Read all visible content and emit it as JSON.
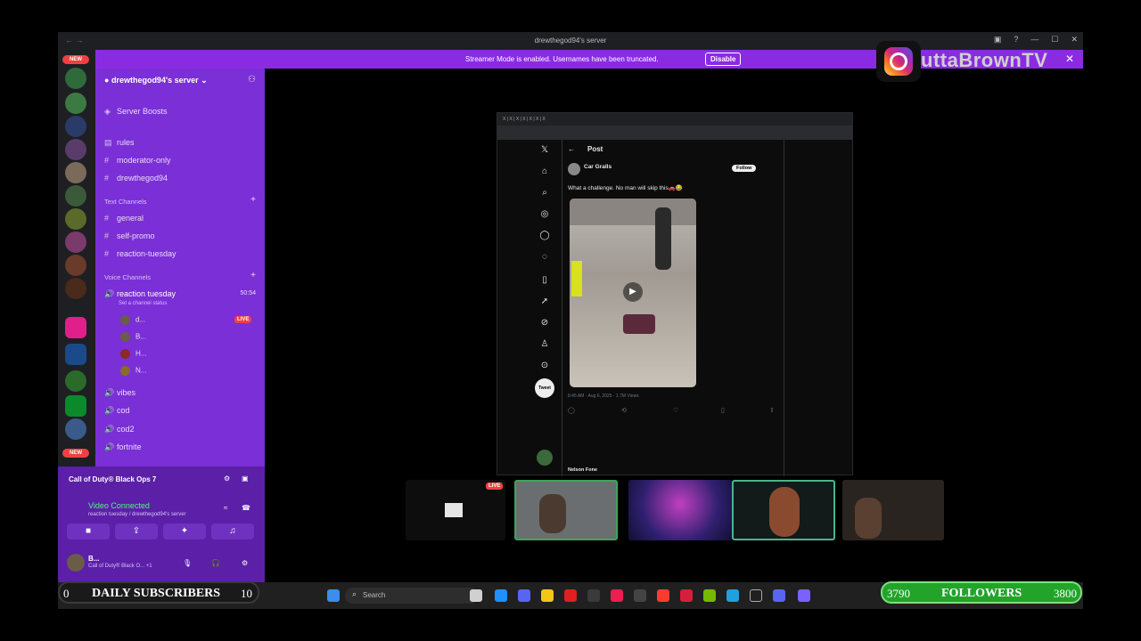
{
  "titlebar": {
    "title": "drewthegod94's server",
    "nav": "←  →"
  },
  "banner": {
    "message": "Streamer Mode is enabled. Usernames have been truncated.",
    "disable_label": "Disable",
    "close": "✕"
  },
  "rail": {
    "new_label": "NEW"
  },
  "server": {
    "name": "drewthegod94's server",
    "items": [
      {
        "label": "Server Boosts",
        "sym": "◈"
      },
      {
        "label": "rules",
        "sym": "▤"
      },
      {
        "label": "moderator-only",
        "sym": "#"
      },
      {
        "label": "drewthegod94",
        "sym": "#"
      }
    ],
    "text_category": "Text Channels",
    "text_channels": [
      "general",
      "self-promo",
      "reaction-tuesday"
    ],
    "voice_category": "Voice Channels",
    "active_voice": {
      "label": "reaction tuesday",
      "time": "50:54",
      "status": "Set a channel status"
    },
    "voice_users": [
      "d...",
      "B...",
      "H...",
      "N..."
    ],
    "live_label": "LIVE",
    "other_voice": [
      "vibes",
      "cod",
      "cod2",
      "fortnite"
    ]
  },
  "bottom": {
    "activity": "Call of Duty® Black Ops 7",
    "video_connected": "Video Connected",
    "video_sub": "reaction tuesday / drewthegod94's server",
    "user": "B...",
    "user_status": "Call of Duty® Black O... +1"
  },
  "twitter": {
    "header": "Post",
    "author": "Car Gralls",
    "follow": "Follow",
    "tweet": "What a challenge. No man will skip this🚗😂",
    "meta": "8:45 AM · Aug 6, 2025 · 1.7M Views",
    "reply_author": "Nelson Fone",
    "tweet_button": "Tweet",
    "tabs": "X | X | X | X | X | X | X"
  },
  "tiles": {
    "live_label": "LIVE"
  },
  "taskbar": {
    "search_placeholder": "Search"
  },
  "overlay": {
    "instagram_name": "uttaBrownTV",
    "daily_subs": {
      "label": "DAILY SUBSCRIBERS",
      "current": "0",
      "goal": "10"
    },
    "followers": {
      "label": "FOLLOWERS",
      "current": "3790",
      "goal": "3800"
    }
  }
}
